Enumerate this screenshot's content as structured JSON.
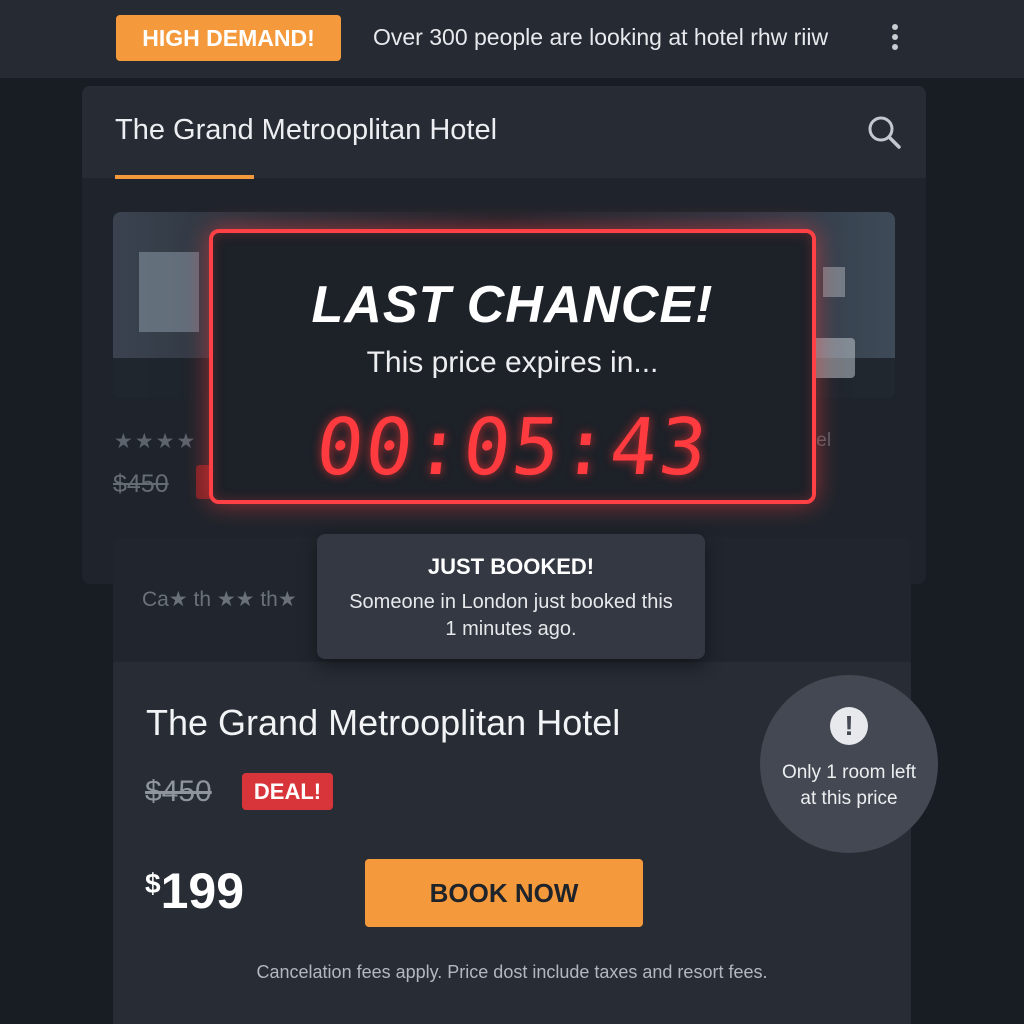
{
  "banner": {
    "badge": "HIGH DEMAND!",
    "message": "Over 300 people are looking at hotel rhw riiw",
    "menu_icon": "more-vertical-icon"
  },
  "header": {
    "title": "The Grand Metrooplitan Hotel",
    "search_icon": "search-icon"
  },
  "background_listing": {
    "stars": "★★★★",
    "old_price": "$450",
    "partial_text": "tel"
  },
  "countdown": {
    "title": "LAST CHANCE!",
    "subtitle": "This price expires in...",
    "timer": "00:05:43"
  },
  "faded_row": {
    "text": "Ca★ th ★★ th★"
  },
  "toast": {
    "title": "JUST BOOKED!",
    "line1": "Someone in London just booked this",
    "line2": "1 minutes ago."
  },
  "listing": {
    "name": "The Grand Metrooplitan Hotel",
    "old_price": "$450",
    "deal_badge": "DEAL!",
    "price_currency": "$",
    "price_amount": "199",
    "book_label": "BOOK NOW"
  },
  "scarcity": {
    "icon": "exclamation-icon",
    "line1": "Only 1 room left",
    "line2": "at this price"
  },
  "disclaimer": "Cancelation fees apply. Price dost include taxes and resort fees.",
  "colors": {
    "accent": "#f59a3c",
    "danger": "#ff3b3f",
    "background": "#181c23"
  }
}
